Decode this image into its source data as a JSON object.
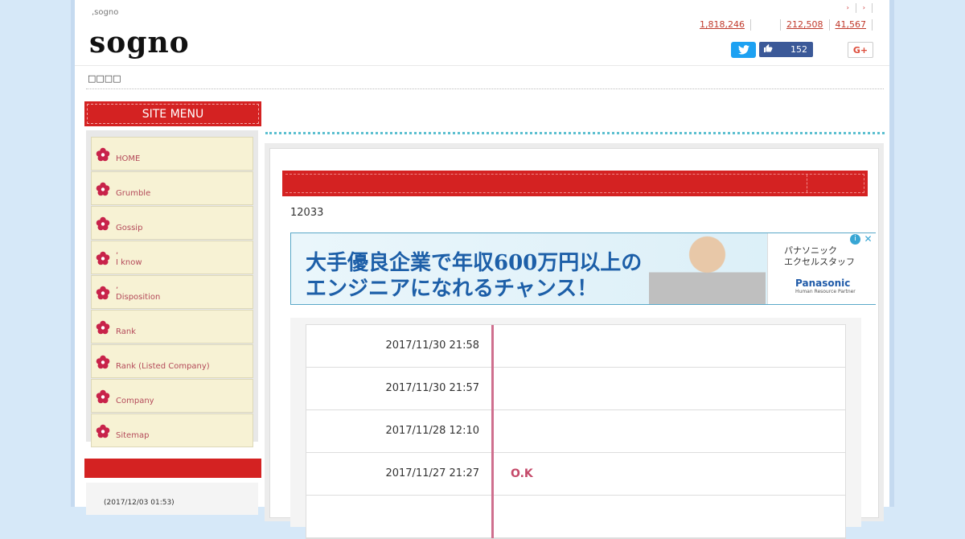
{
  "header": {
    "tagline": ",sogno",
    "logo": "sogno",
    "top_links": [
      "›",
      "›"
    ],
    "stats": [
      "1,818,246",
      "212,508",
      "41,567"
    ],
    "facebook_count": "152",
    "gplus_label": "G+"
  },
  "breadcrumb": "□□□□",
  "sidebar": {
    "menu_title": "SITE MENU",
    "items": [
      {
        "pre": "",
        "label": "HOME"
      },
      {
        "pre": "",
        "label": "Grumble"
      },
      {
        "pre": "",
        "label": "Gossip"
      },
      {
        "pre": ",",
        "label": "I know"
      },
      {
        "pre": ",",
        "label": "Disposition"
      },
      {
        "pre": "",
        "label": "Rank"
      },
      {
        "pre": "",
        "label": "Rank (Listed Company)"
      },
      {
        "pre": "",
        "label": "Company"
      },
      {
        "pre": "",
        "label": "Sitemap"
      }
    ],
    "recent_date": "(2017/12/03 01:53)"
  },
  "main": {
    "count": "12033",
    "ad": {
      "line1": "大手優良企業で年収600万円以上の",
      "line2": "エンジニアになれるチャンス！",
      "brand_jp": "パナソニック\nエクセルスタッフ",
      "brand": "Panasonic",
      "brand_sub": "Human Resource Partner"
    },
    "rows": [
      {
        "date": "2017/11/30 21:58",
        "msg": ""
      },
      {
        "date": "2017/11/30 21:57",
        "msg": ""
      },
      {
        "date": "2017/11/28 12:10",
        "msg": ""
      },
      {
        "date": "2017/11/27 21:27",
        "msg": "O.K"
      },
      {
        "date": "",
        "msg": ""
      }
    ]
  },
  "colors": {
    "accent_red": "#d42222",
    "menu_bg": "#f7f2d4",
    "link_red": "#c0392b",
    "dots_blue": "#5bbfd0"
  }
}
